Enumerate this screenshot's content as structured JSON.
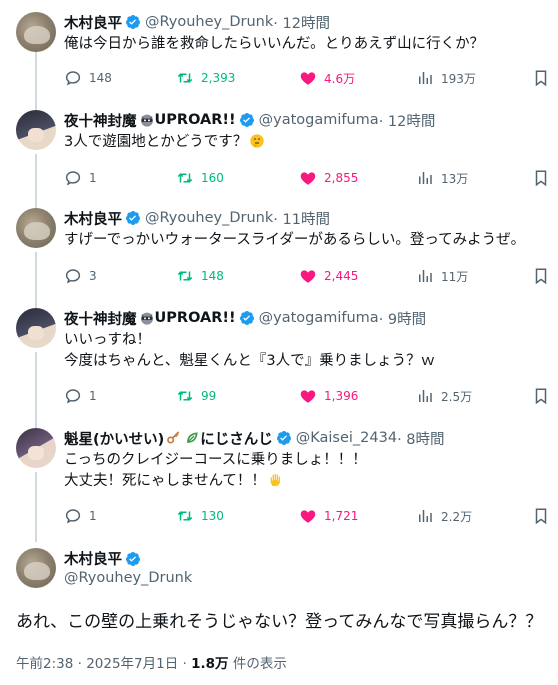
{
  "tweets": [
    {
      "name": "木村良平",
      "handle": "@Ryouhey_Drunk",
      "time": " · 12時間",
      "lines": [
        "俺は今日から誰を救命したらいいんだ。とりあえず山に行くか？"
      ],
      "reply": "148",
      "retweet": "2,393",
      "like": "4.6万",
      "views": "193万",
      "liked": true
    },
    {
      "name": "夜十神封魔",
      "name_suffix": "UPROAR!!",
      "handle": "@yatogamifuma",
      "time": " · 12時間",
      "lines": [
        "3人で遊園地とかどうです？"
      ],
      "reply": "1",
      "retweet": "160",
      "like": "2,855",
      "views": "13万",
      "liked": true
    },
    {
      "name": "木村良平",
      "handle": "@Ryouhey_Drunk",
      "time": " · 11時間",
      "lines": [
        "すげーでっかいウォータースライダーがあるらしい。登ってみようぜ。"
      ],
      "reply": "3",
      "retweet": "148",
      "like": "2,445",
      "views": "11万",
      "liked": true
    },
    {
      "name": "夜十神封魔",
      "name_suffix": "UPROAR!!",
      "handle": "@yatogamifuma",
      "time": " · 9時間",
      "lines": [
        "いいっすね！",
        "今度はちゃんと、魁星くんと『3人で』乗りましょう？ｗ"
      ],
      "reply": "1",
      "retweet": "99",
      "like": "1,396",
      "views": "2.5万",
      "liked": true
    },
    {
      "name": "魁星(かいせい)",
      "name_suffix": "にじさんじ",
      "handle": "@Kaisei_2434",
      "time": " · 8時間",
      "lines": [
        "こっちのクレイジーコースに乗りましょ！！！",
        "大丈夫！死にゃしませんて！！"
      ],
      "reply": "1",
      "retweet": "130",
      "like": "1,721",
      "views": "2.2万",
      "liked": true
    }
  ],
  "main": {
    "name": "木村良平",
    "handle": "@Ryouhey_Drunk",
    "text": "あれ、この壁の上乗れそうじゃない？登ってみんなで写真撮らん？？",
    "timestamp": "午前2:38 · 2025年7月1日 · ",
    "views_count": "1.8万",
    "views_label": " 件の表示"
  },
  "colors": {
    "text": "#0f1419",
    "secondary": "#536471",
    "verified": "#1d9bf0",
    "retweet": "#00ba7c",
    "like": "#f91880",
    "thread_line": "#cfd9de"
  },
  "icons": {
    "reply": "reply-icon",
    "retweet": "retweet-icon",
    "like": "heart-icon",
    "views": "views-icon",
    "bookmark": "bookmark-icon",
    "verified": "verified-badge-icon"
  }
}
